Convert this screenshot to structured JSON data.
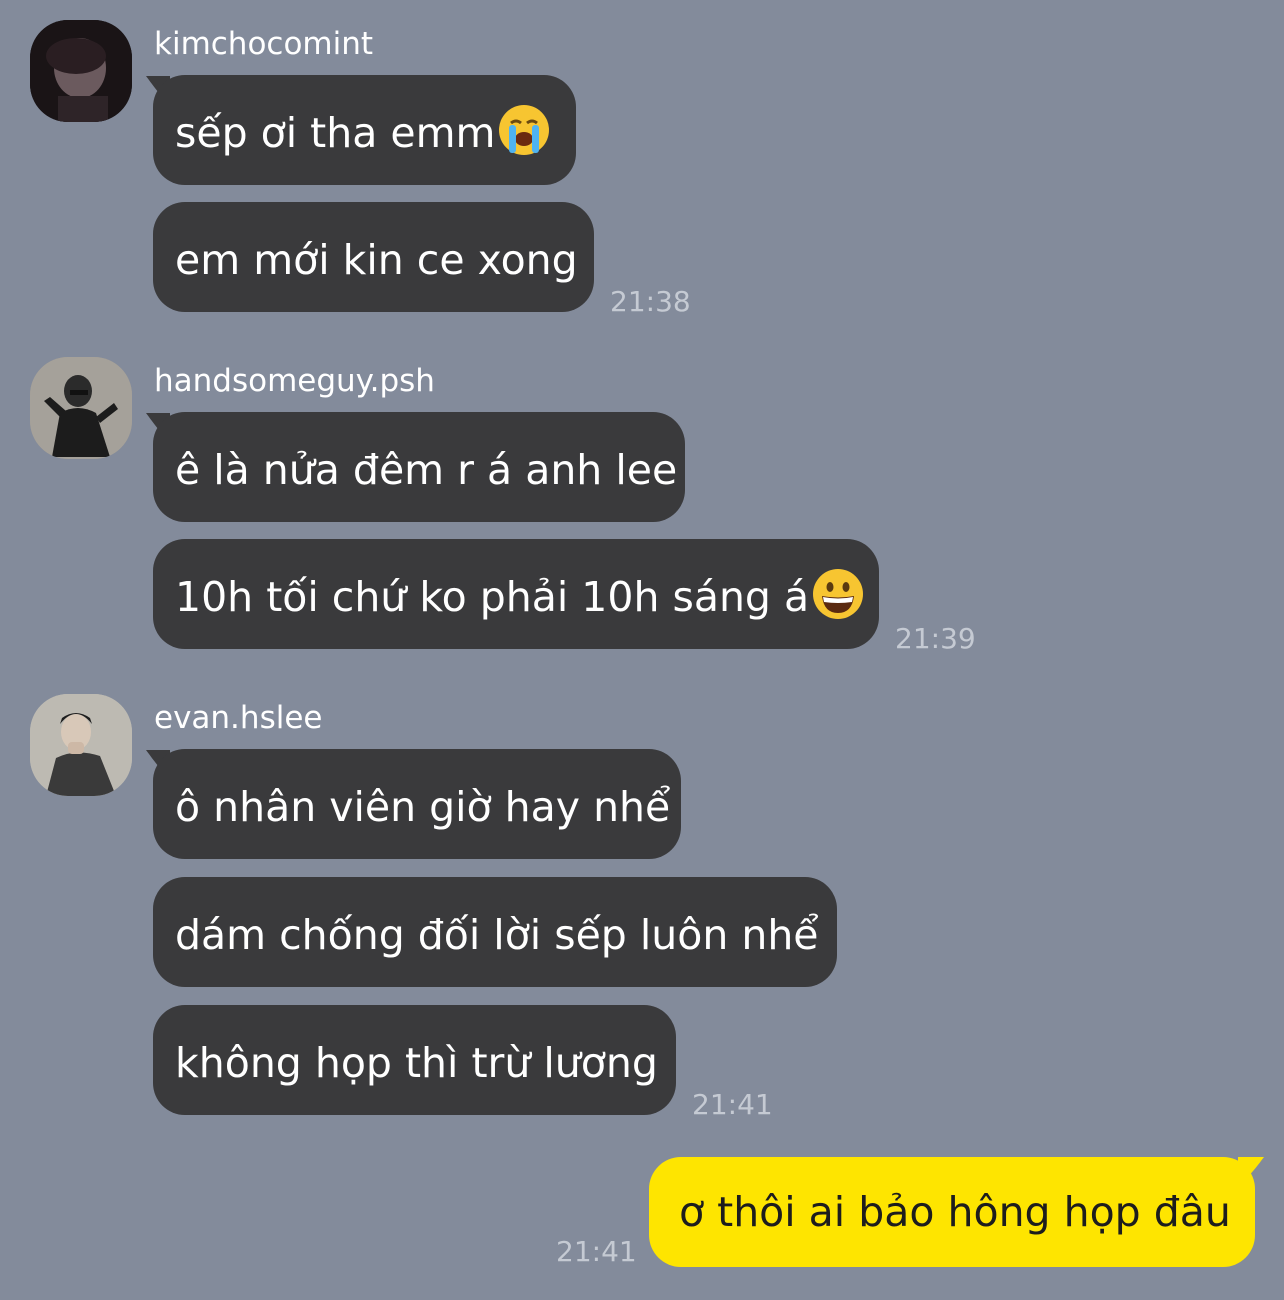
{
  "groups": [
    {
      "sender": "kimchocomint",
      "avatar_icon": "avatar-photo-icon",
      "messages": [
        "sếp ơi tha emm",
        "em mới kin ce xong"
      ],
      "emoji_after_first": "loudly-crying-face-emoji",
      "time": "21:38"
    },
    {
      "sender": "handsomeguy.psh",
      "avatar_icon": "avatar-photo-icon",
      "messages": [
        "ê là nửa đêm r á anh lee",
        "10h tối chứ ko phải 10h sáng á"
      ],
      "emoji_after_second": "grinning-face-emoji",
      "time": "21:39"
    },
    {
      "sender": "evan.hslee",
      "avatar_icon": "avatar-photo-icon",
      "messages": [
        "ô nhân viên giờ hay nhể",
        "dám chống đối lời sếp luôn nhể",
        "không họp thì trừ lương"
      ],
      "time": "21:41"
    }
  ],
  "my_message": {
    "text": "ơ thôi ai bảo hông họp đâu",
    "time": "21:41"
  },
  "colors": {
    "background": "#838b9b",
    "incoming_bubble": "#3a3a3c",
    "outgoing_bubble": "#fee500"
  }
}
